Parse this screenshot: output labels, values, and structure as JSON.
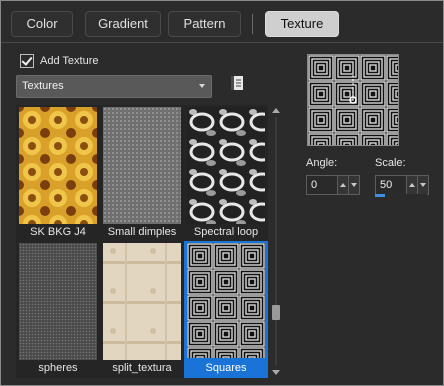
{
  "tabs": [
    {
      "label": "Color",
      "active": false
    },
    {
      "label": "Gradient",
      "active": false
    },
    {
      "label": "Pattern",
      "active": false
    },
    {
      "label": "Texture",
      "active": true
    }
  ],
  "add_texture": {
    "label": "Add Texture",
    "checked": true
  },
  "category": {
    "selected": "Textures"
  },
  "textures": [
    {
      "name": "SK BKG J4",
      "selected": false
    },
    {
      "name": "Small dimples",
      "selected": false
    },
    {
      "name": "Spectral loop",
      "selected": false
    },
    {
      "name": "spheres",
      "selected": false
    },
    {
      "name": "split_textura",
      "selected": false
    },
    {
      "name": "Squares",
      "selected": true
    }
  ],
  "angle": {
    "label": "Angle:",
    "value": "0"
  },
  "scale": {
    "label": "Scale:",
    "value": "50",
    "level_fraction": 0.2
  },
  "colors": {
    "selection": "#1a74d8",
    "active_tab": "#cfcfcf",
    "scale_bar": "#3d8fe0"
  },
  "icons": [
    "book-icon",
    "chevron-down-icon",
    "scroll-up-icon",
    "scroll-down-icon"
  ]
}
